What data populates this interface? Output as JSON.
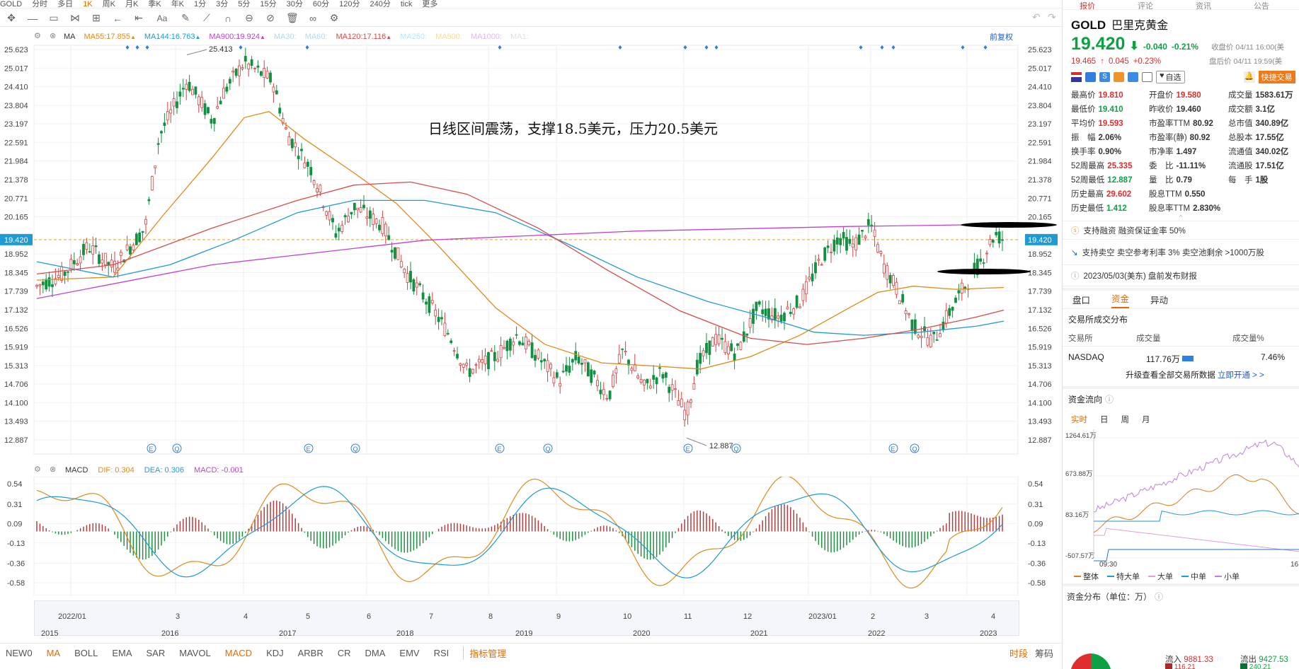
{
  "topbar": {
    "items": [
      "GOLD",
      "分时",
      "多日",
      "1K",
      "周K",
      "月K",
      "季K",
      "年K",
      "1分",
      "3分",
      "5分",
      "15分",
      "30分",
      "60分",
      "120分",
      "240分",
      "tick",
      "更多"
    ]
  },
  "toolbar": {
    "icons": [
      "move-icon",
      "line-icon",
      "rect-icon",
      "channel-icon",
      "fib-icon",
      "arrow-icon",
      "text-icon",
      "pen-icon",
      "arc-icon",
      "circle-icon",
      "eraser-icon",
      "delete-icon",
      "glasses-icon",
      "gear-icon",
      "undo-icon",
      "redo-icon"
    ],
    "text_tool": "Aa"
  },
  "ma": {
    "label": "MA",
    "items": [
      {
        "name": "MA55:",
        "value": "17.855",
        "color": "#e08a1a",
        "arrow": "▲"
      },
      {
        "name": "MA144:",
        "value": "16.763",
        "color": "#1e9ad6",
        "arrow": "▲"
      },
      {
        "name": "MA900:",
        "value": "19.924",
        "color": "#c040d0",
        "arrow": "▲"
      },
      {
        "name": "MA30:",
        "value": "",
        "color": "#b9d7ee",
        "arrow": ""
      },
      {
        "name": "MA60:",
        "value": "",
        "color": "#b9d7ee",
        "arrow": ""
      },
      {
        "name": "MA120:",
        "value": "17.116",
        "color": "#d84b4b",
        "arrow": "▲"
      },
      {
        "name": "MA250:",
        "value": "",
        "color": "#b9e6f6",
        "arrow": ""
      },
      {
        "name": "MA500:",
        "value": "",
        "color": "#f4dca0",
        "arrow": ""
      },
      {
        "name": "MA1000:",
        "value": "",
        "color": "#e0b8f0",
        "arrow": ""
      },
      {
        "name": "MA1:",
        "value": "",
        "color": "#e0e0e0",
        "arrow": ""
      }
    ],
    "fq": "前复权"
  },
  "annotation": "日线区间震荡，支撑18.5美元，压力20.5美元",
  "price_axis": [
    "25.623",
    "25.017",
    "24.410",
    "23.804",
    "23.197",
    "22.591",
    "21.984",
    "21.378",
    "20.771",
    "20.165",
    "19.420",
    "18.952",
    "18.345",
    "17.739",
    "17.132",
    "16.526",
    "15.919",
    "15.313",
    "14.706",
    "14.100",
    "13.493",
    "12.887"
  ],
  "current_price_tag": "19.420",
  "high_label": "25.413",
  "low_label": "12.887",
  "event_markers": [
    "E",
    "Q",
    "E",
    "Q",
    "E",
    "Q",
    "E",
    "Q",
    "E",
    "Q"
  ],
  "macd": {
    "label": "MACD",
    "dif_name": "DIF:",
    "dif": "0.304",
    "dea_name": "DEA:",
    "dea": "0.306",
    "macd_name": "MACD:",
    "macd": "-0.001",
    "axis": [
      "0.54",
      "0.31",
      "0.09",
      "-0.13",
      "-0.36",
      "-0.58"
    ]
  },
  "x_labels": [
    "2022/01",
    "3",
    "4",
    "5",
    "6",
    "7",
    "8",
    "9",
    "10",
    "11",
    "12",
    "2023/01",
    "2",
    "3",
    "4"
  ],
  "nav_years": [
    "2015",
    "2016",
    "2017",
    "2018",
    "2019",
    "2020",
    "2021",
    "2022",
    "2023"
  ],
  "bottom_indicators": [
    "NEW0",
    "MA",
    "BOLL",
    "EMA",
    "SAR",
    "MAVOL",
    "MACD",
    "KDJ",
    "ARBR",
    "CR",
    "DMA",
    "EMV",
    "RSI"
  ],
  "bottom_manage": "指标管理",
  "bottom_right": [
    "时段",
    "筹码"
  ],
  "quote": {
    "tabs": [
      "报价",
      "评论",
      "资讯",
      "公告"
    ],
    "symbol": "GOLD",
    "name": "巴里克黄金",
    "price": "19.420",
    "change": "-0.040",
    "pct": "-0.21%",
    "close_label": "收盘价 04/11 16:00(美",
    "post_price": "19.465",
    "post_change": "0.045",
    "post_pct": "+0.23%",
    "post_label": "盘后价 04/11 19:59(美",
    "watch": "自选",
    "quick_trade": "快捷交易",
    "stats": [
      [
        "最高价",
        "19.810",
        "red",
        "开盘价",
        "19.580",
        "red",
        "成交量",
        "1583.61万",
        ""
      ],
      [
        "最低价",
        "19.410",
        "grn",
        "昨收价",
        "19.460",
        "",
        "成交额",
        "3.1亿",
        ""
      ],
      [
        "平均价",
        "19.593",
        "red",
        "市盈率TTM",
        "80.92",
        "",
        "总市值",
        "340.89亿",
        ""
      ],
      [
        "振　幅",
        "2.06%",
        "",
        "市盈率(静)",
        "80.92",
        "",
        "总股本",
        "17.55亿",
        ""
      ],
      [
        "换手率",
        "0.90%",
        "",
        "市净率",
        "1.497",
        "",
        "流通值",
        "340.02亿",
        ""
      ],
      [
        "52周最高",
        "25.335",
        "red",
        "委　比",
        "-11.11%",
        "",
        "流通股",
        "17.51亿",
        ""
      ],
      [
        "52周最低",
        "12.887",
        "grn",
        "量　比",
        "0.79",
        "",
        "每　手",
        "1股",
        ""
      ],
      [
        "历史最高",
        "29.602",
        "red",
        "股息TTM",
        "0.550",
        "",
        "",
        "",
        ""
      ],
      [
        "历史最低",
        "1.412",
        "grn",
        "股息率TTM",
        "2.830%",
        "",
        "",
        "",
        ""
      ]
    ],
    "info1": "支持融资  融资保证金率 50%",
    "info2": "支持卖空  卖空参考利率 3%  卖空池剩余 >1000万股",
    "info3": "2023/05/03(美东)  盘前发布财报",
    "subtabs": [
      "盘口",
      "资金",
      "异动"
    ],
    "exch_title": "交易所成交分布",
    "exch_headers": [
      "交易所",
      "成交量",
      "成交量%"
    ],
    "exch_row": [
      "NASDAQ",
      "117.76万",
      "7.46%"
    ],
    "upgrade": "升级查看全部交易所数据",
    "upgrade_link": "立即开通 > >",
    "flow_title": "资金流向",
    "flow_tabs": [
      "实时",
      "日",
      "周",
      "月"
    ],
    "flow_axis": [
      "1264.61万",
      "673.88万",
      "83.16万",
      "-507.57万"
    ],
    "flow_time": [
      "09:30",
      "16"
    ],
    "flow_legend": [
      "整体",
      "特大单",
      "大单",
      "中单",
      "小单"
    ],
    "dist_title": "资金分布（单位：万）",
    "inflow_label": "流入",
    "inflow": "9881.33",
    "outflow_label": "流出",
    "outflow": "9427.53",
    "dist_small": [
      "116.21",
      "240.21"
    ]
  }
}
